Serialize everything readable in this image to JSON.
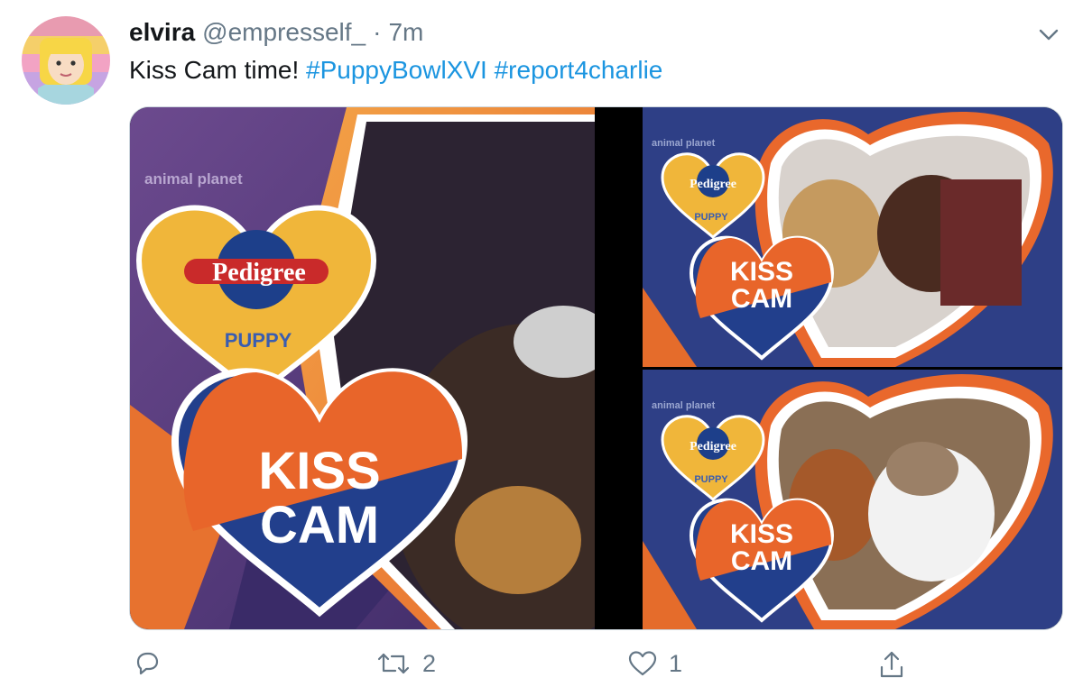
{
  "tweet": {
    "author": {
      "name": "elvira",
      "handle": "@empresself_",
      "separator": "·",
      "timestamp": "7m"
    },
    "text": {
      "plain": "Kiss Cam time!",
      "hashtags": [
        "#PuppyBowlXVI",
        "#report4charlie"
      ]
    },
    "media": {
      "count": 3,
      "overlay": {
        "channel_logo": "animal planet",
        "sponsor": "Pedigree",
        "sponsor_sub": "PUPPY",
        "kiss_cam_line1": "KISS",
        "kiss_cam_line2": "CAM"
      }
    },
    "actions": {
      "reply": {
        "icon": "reply-icon",
        "count": ""
      },
      "retweet": {
        "icon": "retweet-icon",
        "count": "2"
      },
      "like": {
        "icon": "heart-icon",
        "count": "1"
      },
      "share": {
        "icon": "share-icon",
        "count": ""
      }
    }
  },
  "colors": {
    "text": "#14171a",
    "secondary": "#657786",
    "link": "#1b95e0",
    "kiss_cam_orange": "#e8652a",
    "kiss_cam_navy": "#223f8c",
    "pedigree_yellow": "#f0b63a"
  }
}
